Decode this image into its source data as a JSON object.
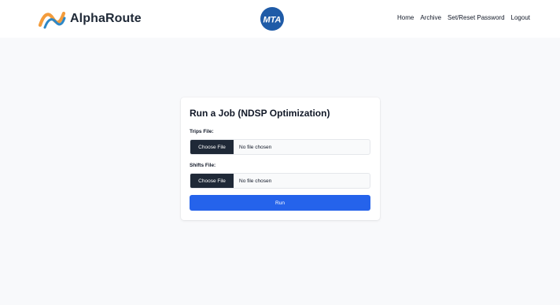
{
  "brand": {
    "name": "AlphaRoute",
    "logo_icon": "alpharoute-logo-icon"
  },
  "partner_logo": {
    "icon": "mta-logo-icon",
    "text": "MTA",
    "color": "#1f5ba7"
  },
  "nav": {
    "links": [
      {
        "label": "Home"
      },
      {
        "label": "Archive"
      },
      {
        "label": "Set/Reset Password"
      },
      {
        "label": "Logout"
      }
    ]
  },
  "form": {
    "title": "Run a Job (NDSP Optimization)",
    "trips": {
      "label": "Trips File:",
      "button_label": "Choose File",
      "status": "No file chosen"
    },
    "shifts": {
      "label": "Shifts File:",
      "button_label": "Choose File",
      "status": "No file chosen"
    },
    "run_label": "Run"
  },
  "colors": {
    "page_background": "#f8f9fb",
    "run_button": "#2563eb",
    "choose_file_button": "#1f2937",
    "logo_orange": "#f39c3c",
    "logo_blue": "#2e88c7"
  }
}
